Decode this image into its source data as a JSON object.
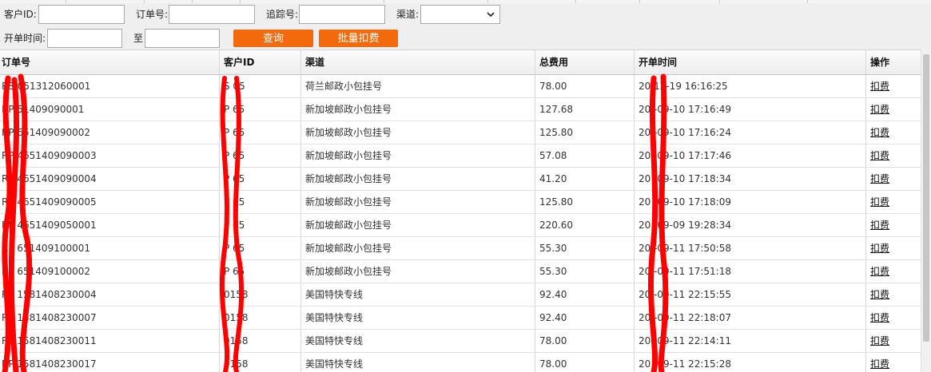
{
  "filters": {
    "customer_id_label": "客户ID:",
    "customer_id_value": "",
    "order_no_label": "订单号:",
    "order_no_value": "",
    "tracking_no_label": "追踪号:",
    "tracking_no_value": "",
    "channel_label": "渠道:",
    "channel_value": "",
    "open_time_label": "开单时间:",
    "open_time_from": "",
    "to_label": "至",
    "open_time_to": "",
    "query_button": "查询",
    "batch_charge_button": "批量扣费"
  },
  "table": {
    "columns": [
      "订单号",
      "客户ID",
      "渠道",
      "总费用",
      "开单时间",
      "操作"
    ],
    "rows": [
      {
        "order_no": "RS  051312060001",
        "customer_id": "S  05",
        "channel": "荷兰邮政小包挂号",
        "total": "78.00",
        "open_time": "20  12-19 16:16:25",
        "action": "扣费"
      },
      {
        "order_no": "RP  51409090001",
        "customer_id": "P  65",
        "channel": "新加坡邮政小包挂号",
        "total": "127.68",
        "open_time": "20  -09-10 17:16:49",
        "action": "扣费"
      },
      {
        "order_no": "RP  651409090002",
        "customer_id": "P  65",
        "channel": "新加坡邮政小包挂号",
        "total": "125.80",
        "open_time": "20  -09-10 17:16:24",
        "action": "扣费"
      },
      {
        "order_no": "RP  4651409090003",
        "customer_id": "P  65",
        "channel": "新加坡邮政小包挂号",
        "total": "57.08",
        "open_time": "20  -09-10 17:17:46",
        "action": "扣费"
      },
      {
        "order_no": "RP  4651409090004",
        "customer_id": "P  65",
        "channel": "新加坡邮政小包挂号",
        "total": "41.20",
        "open_time": "20  -09-10 17:18:34",
        "action": "扣费"
      },
      {
        "order_no": "RP  4651409090005",
        "customer_id": "P  65",
        "channel": "新加坡邮政小包挂号",
        "total": "125.80",
        "open_time": "20  -09-10 17:18:09",
        "action": "扣费"
      },
      {
        "order_no": "RP  4651409050001",
        "customer_id": "P  65",
        "channel": "新加坡邮政小包挂号",
        "total": "220.60",
        "open_time": "20  -09-09 19:28:34",
        "action": "扣费"
      },
      {
        "order_no": "RP  651409100001",
        "customer_id": "P  65",
        "channel": "新加坡邮政小包挂号",
        "total": "55.30",
        "open_time": "20  -09-11 17:50:58",
        "action": "扣费"
      },
      {
        "order_no": "RP  651409100002",
        "customer_id": "P  65",
        "channel": "新加坡邮政小包挂号",
        "total": "55.30",
        "open_time": "20  -09-11 17:51:18",
        "action": "扣费"
      },
      {
        "order_no": "RP  1581408230004",
        "customer_id": "  0158",
        "channel": "美国特快专线",
        "total": "92.40",
        "open_time": "20  -09-11 22:15:55",
        "action": "扣费"
      },
      {
        "order_no": "RP  1581408230007",
        "customer_id": "  0158",
        "channel": "美国特快专线",
        "total": "92.40",
        "open_time": "20  -09-11 22:18:07",
        "action": "扣费"
      },
      {
        "order_no": "RP  1581408230011",
        "customer_id": "  0158",
        "channel": "美国特快专线",
        "total": "78.00",
        "open_time": "20  -09-11 22:14:11",
        "action": "扣费"
      },
      {
        "order_no": "RP  1581408230017",
        "customer_id": "  0158",
        "channel": "美国特快专线",
        "total": "78.00",
        "open_time": "20  -09-11 22:15:28",
        "action": "扣费"
      }
    ]
  },
  "colors": {
    "button_bg": "#f36a0d",
    "redaction_stroke": "#ff0000",
    "filter_bg": "#efefef"
  },
  "icons": {
    "select_arrow": "chevron-down-icon"
  }
}
